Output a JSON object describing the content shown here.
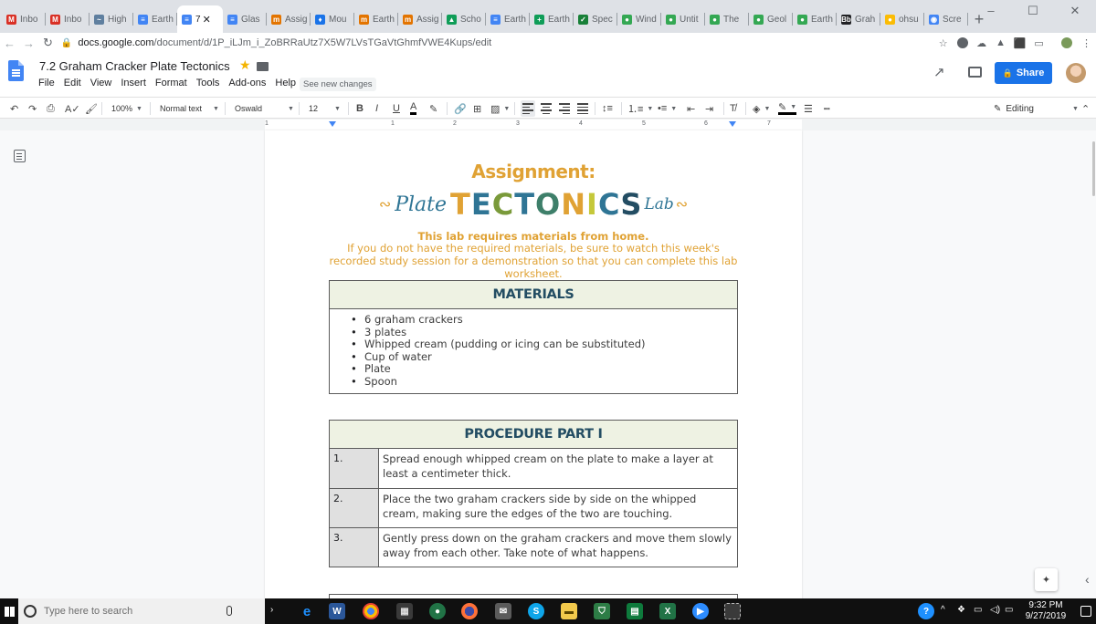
{
  "browser": {
    "tabs": [
      {
        "label": "Inbo",
        "icon": "gmail-icon",
        "color": "#d93025",
        "glyph": "M"
      },
      {
        "label": "Inbo",
        "icon": "gmail-icon",
        "color": "#d93025",
        "glyph": "M"
      },
      {
        "label": "High",
        "icon": "site-icon",
        "color": "#5f7f9f",
        "glyph": "~"
      },
      {
        "label": "Earth",
        "icon": "docs-icon",
        "color": "#4285f4",
        "glyph": "≡"
      },
      {
        "label": "7",
        "icon": "docs-icon",
        "color": "#4285f4",
        "glyph": "≡",
        "active": true
      },
      {
        "label": "Glas",
        "icon": "docs-icon",
        "color": "#4285f4",
        "glyph": "≡"
      },
      {
        "label": "Assig",
        "icon": "classroom-icon",
        "color": "#e37400",
        "glyph": "m"
      },
      {
        "label": "Mou",
        "icon": "drop-icon",
        "color": "#1a73e8",
        "glyph": "♦"
      },
      {
        "label": "Earth",
        "icon": "classroom-icon",
        "color": "#e37400",
        "glyph": "m"
      },
      {
        "label": "Assig",
        "icon": "classroom-icon",
        "color": "#e37400",
        "glyph": "m"
      },
      {
        "label": "Scho",
        "icon": "drive-icon",
        "color": "#0f9d58",
        "glyph": "▲"
      },
      {
        "label": "Earth",
        "icon": "docs-icon",
        "color": "#4285f4",
        "glyph": "≡"
      },
      {
        "label": "Earth",
        "icon": "slides-icon",
        "color": "#0f9d58",
        "glyph": "+"
      },
      {
        "label": "Spec",
        "icon": "sheets-icon",
        "color": "#188038",
        "glyph": "✓"
      },
      {
        "label": "Wind",
        "icon": "cloud-icon",
        "color": "#34a853",
        "glyph": "●"
      },
      {
        "label": "Untit",
        "icon": "cloud-icon",
        "color": "#34a853",
        "glyph": "●"
      },
      {
        "label": "The",
        "icon": "cloud-icon",
        "color": "#34a853",
        "glyph": "●"
      },
      {
        "label": "Geol",
        "icon": "cloud-icon",
        "color": "#34a853",
        "glyph": "●"
      },
      {
        "label": "Earth",
        "icon": "cloud-icon",
        "color": "#34a853",
        "glyph": "●"
      },
      {
        "label": "Grah",
        "icon": "blackboard-icon",
        "color": "#202124",
        "glyph": "Bb"
      },
      {
        "label": "ohsu",
        "icon": "bulb-icon",
        "color": "#fbbc04",
        "glyph": "●"
      },
      {
        "label": "Scre",
        "icon": "record-icon",
        "color": "#4285f4",
        "glyph": "◉"
      }
    ],
    "address": {
      "host": "docs.google.com",
      "path": "/document/d/1P_iLJm_i_ZoBRRaUtz7X5W7LVsTGaVtGhmfVWE4Kups/edit"
    }
  },
  "docs": {
    "title": "7.2 Graham Cracker Plate Tectonics",
    "menus": [
      "File",
      "Edit",
      "View",
      "Insert",
      "Format",
      "Tools",
      "Add-ons",
      "Help"
    ],
    "see_changes": "See new changes",
    "share_label": "Share",
    "toolbar": {
      "zoom": "100%",
      "style": "Normal text",
      "font": "Oswald",
      "size": "12",
      "bold": "B",
      "italic": "I",
      "underline": "U",
      "text_color": "A",
      "mode": "Editing"
    },
    "ruler_numbers": [
      "1",
      "1",
      "2",
      "3",
      "4",
      "5",
      "6",
      "7"
    ]
  },
  "document": {
    "heading": "Assignment:",
    "title_left": "Plate",
    "title_letters": [
      {
        "ch": "T",
        "color": "#e0a234"
      },
      {
        "ch": "E",
        "color": "#2f7595"
      },
      {
        "ch": "C",
        "color": "#7a9a3a"
      },
      {
        "ch": "T",
        "color": "#2f7595"
      },
      {
        "ch": "O",
        "color": "#3e7f6a"
      },
      {
        "ch": "N",
        "color": "#e0a234"
      },
      {
        "ch": "I",
        "color": "#c5c83a"
      },
      {
        "ch": "C",
        "color": "#2f7595"
      },
      {
        "ch": "S",
        "color": "#234d63"
      }
    ],
    "title_right": "Lab",
    "intro_bold": "This lab requires materials from home.",
    "intro_text": "If you do not have the required materials, be sure to watch this week's recorded study session for a demonstration so that you can complete this lab worksheet.",
    "materials": {
      "header": "MATERIALS",
      "items": [
        "6 graham crackers",
        "3 plates",
        "Whipped cream (pudding or icing can be substituted)",
        "Cup of water",
        "Plate",
        "Spoon"
      ]
    },
    "procedure": {
      "header": "PROCEDURE PART I",
      "steps": [
        {
          "num": "1.",
          "text": "Spread enough whipped cream on the plate to make a layer at least a centimeter thick."
        },
        {
          "num": "2.",
          "text": "Place the two graham crackers side by side on the whipped cream, making sure the edges of the two are touching."
        },
        {
          "num": "3.",
          "text": "Gently press down on the graham crackers and move them slowly away from each other.  Take note of what happens."
        }
      ]
    }
  },
  "taskbar": {
    "search_placeholder": "Type here to search",
    "time": "9:32 PM",
    "date": "9/27/2019"
  }
}
